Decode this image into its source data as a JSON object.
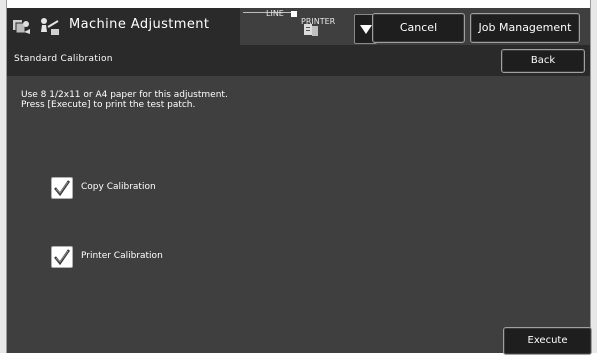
{
  "header": {
    "title": "Machine Adjustment",
    "line_text": "LINE",
    "printer_text": "PRINTER",
    "cancel_label": "Cancel",
    "job_management_label": "Job Management"
  },
  "subheader": {
    "title": "Standard Calibration",
    "back_label": "Back"
  },
  "content": {
    "instruction_line1": "Use 8 1/2x11 or A4 paper for this adjustment.",
    "instruction_line2": "Press [Execute] to print the test patch.",
    "options": [
      {
        "label": "Copy Calibration",
        "checked": true
      },
      {
        "label": "Printer Calibration",
        "checked": true
      }
    ],
    "execute_label": "Execute"
  },
  "icons": {
    "app": "machine-adjustment-icon",
    "adjust": "calibration-icon",
    "printer": "printer-icon",
    "dropdown": "dropdown-arrow-icon",
    "check": "checkmark-icon"
  }
}
